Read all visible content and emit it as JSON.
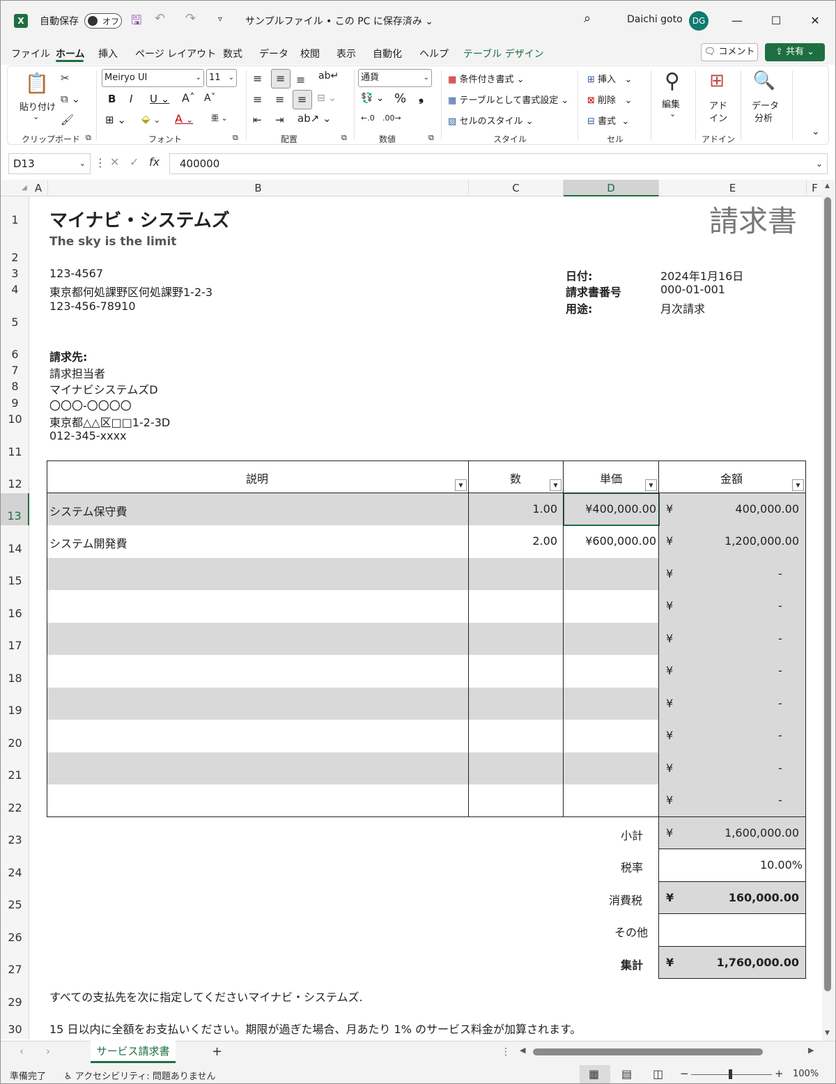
{
  "titlebar": {
    "app_icon": "X",
    "autosave_label": "自動保存",
    "autosave_state": "オフ",
    "file_title": "サンプルファイル • この PC に保存済み ⌄",
    "user_name": "Daichi goto",
    "user_initials": "DG"
  },
  "menu": {
    "tabs": [
      "ファイル",
      "ホーム",
      "挿入",
      "ページ レイアウト",
      "数式",
      "データ",
      "校閲",
      "表示",
      "自動化",
      "ヘルプ",
      "テーブル デザイン"
    ],
    "comment": "コメント",
    "share": "共有"
  },
  "ribbon": {
    "clipboard": {
      "paste": "貼り付け",
      "group": "クリップボード"
    },
    "font": {
      "name": "Meiryo UI",
      "size": "11",
      "group": "フォント"
    },
    "alignment": {
      "group": "配置"
    },
    "number": {
      "format": "通貨",
      "group": "数値"
    },
    "styles": {
      "conditional": "条件付き書式",
      "as_table": "テーブルとして書式設定",
      "cell_styles": "セルのスタイル",
      "group": "スタイル"
    },
    "cells": {
      "insert": "挿入",
      "delete": "削除",
      "format": "書式",
      "group": "セル"
    },
    "editing": {
      "label": "編集"
    },
    "addins": {
      "label1": "アド",
      "label2": "イン",
      "group": "アドイン"
    },
    "analysis": {
      "label1": "データ",
      "label2": "分析"
    }
  },
  "formula_bar": {
    "name_box": "D13",
    "value": "400000"
  },
  "columns": [
    "A",
    "B",
    "C",
    "D",
    "E",
    "F"
  ],
  "rows": [
    "1",
    "2",
    "3",
    "4",
    "5",
    "6",
    "7",
    "8",
    "9",
    "10",
    "11",
    "12",
    "13",
    "14",
    "15",
    "16",
    "17",
    "18",
    "19",
    "20",
    "21",
    "22",
    "23",
    "24",
    "25",
    "26",
    "27",
    "29",
    "30"
  ],
  "invoice": {
    "company": "マイナビ・システムズ",
    "slogan": "The sky is the limit",
    "title": "請求書",
    "postal": "123-4567",
    "address": "東京都何処課野区何処課野1-2-3",
    "phone": "123-456-78910",
    "date_label": "日付:",
    "date": "2024年1月16日",
    "number_label": "請求書番号",
    "number": "000-01-001",
    "purpose_label": "用途:",
    "purpose": "月次請求",
    "bill_to_label": "請求先:",
    "bill_to": [
      "請求担当者",
      "マイナビシステムズD",
      "〇〇〇-〇〇〇〇",
      "東京都△△区□□1-2-3D",
      "012-345-xxxx"
    ],
    "headers": {
      "desc": "説明",
      "qty": "数",
      "price": "単価",
      "amount": "金額"
    },
    "items": [
      {
        "desc": "システム保守費",
        "qty": "1.00",
        "price": "¥400,000.00",
        "amount": "400,000.00"
      },
      {
        "desc": "システム開発費",
        "qty": "2.00",
        "price": "¥600,000.00",
        "amount": "1,200,000.00"
      }
    ],
    "yen": "¥",
    "dash": "-",
    "subtotal_label": "小計",
    "subtotal": "1,600,000.00",
    "tax_rate_label": "税率",
    "tax_rate": "10.00%",
    "tax_label": "消費税",
    "tax": "160,000.00",
    "other_label": "その他",
    "total_label": "集計",
    "total": "1,760,000.00",
    "note1": "すべての支払先を次に指定してくださいマイナビ・システムズ.",
    "note2": "15 日以内に全額をお支払いください。期限が過ぎた場合、月あたり 1% のサービス料金が加算されます。"
  },
  "sheet": {
    "tab": "サービス請求書",
    "add": "+"
  },
  "status": {
    "ready": "準備完了",
    "accessibility": "アクセシビリティ: 問題ありません",
    "zoom": "100%"
  }
}
